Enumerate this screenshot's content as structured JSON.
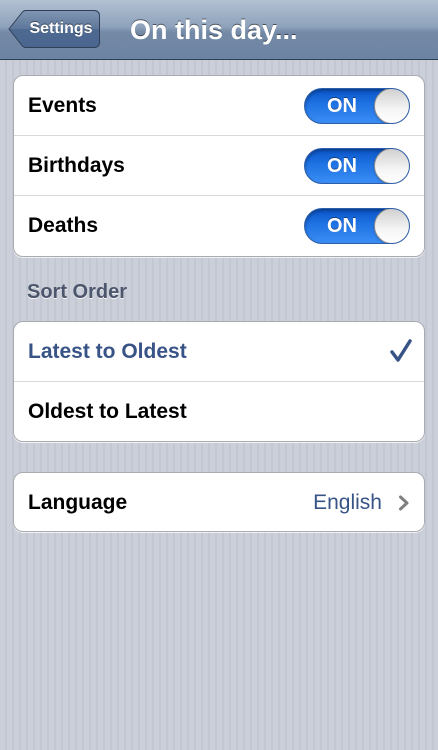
{
  "navbar": {
    "back_label": "Settings",
    "title": "On this day..."
  },
  "toggles": [
    {
      "label": "Events",
      "state": "ON"
    },
    {
      "label": "Birthdays",
      "state": "ON"
    },
    {
      "label": "Deaths",
      "state": "ON"
    }
  ],
  "sort_order": {
    "header": "Sort Order",
    "options": [
      {
        "label": "Latest to Oldest",
        "selected": true
      },
      {
        "label": "Oldest to Latest",
        "selected": false
      }
    ]
  },
  "language": {
    "label": "Language",
    "value": "English"
  },
  "colors": {
    "switch_on": "#1f73e3",
    "selected_text": "#385487",
    "navbar": "#7389a6"
  },
  "icons": {
    "back": "back-arrow-icon",
    "check": "checkmark-icon",
    "disclosure": "chevron-right-icon"
  }
}
